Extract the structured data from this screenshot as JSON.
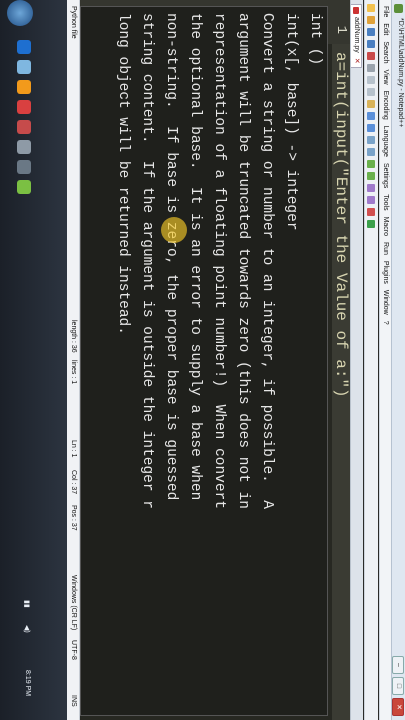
{
  "window": {
    "title": "*D:\\HTML\\addNum.py - Notepad++",
    "controls": [
      "–",
      "□",
      "✕"
    ]
  },
  "menu": [
    "File",
    "Edit",
    "Search",
    "View",
    "Encoding",
    "Language",
    "Settings",
    "Tools",
    "Macro",
    "Run",
    "Plugins",
    "Window",
    "?"
  ],
  "tab": {
    "label": "addNum.py"
  },
  "editor": {
    "line_number": "1",
    "code": "a=int(input(\"Enter the Value of a:\")"
  },
  "calltip": {
    "lines": [
      "int ()",
      "int(x[, base]) -> integer",
      "Convert a string or number to an integer, if possible.  A",
      "argument will be truncated towards zero (this does not in",
      "representation of a floating point number!)  When convert",
      "the optional base.  It is an error to supply a base when",
      "non-string.  If base is zero, the proper base is guessed",
      "string content.  If the argument is outside the integer r",
      "long object will be returned instead."
    ]
  },
  "status": {
    "file_type": "Python file",
    "length": "length : 36",
    "lines": "lines : 1",
    "ln": "Ln : 1",
    "col": "Col : 37",
    "pos": "Pos : 37",
    "eol": "Windows (CR LF)",
    "encoding": "UTF-8",
    "ins": "INS"
  },
  "taskbar": {
    "clock": "8:19 PM"
  },
  "colors": {
    "editor_bg": "#272822",
    "calltip_bg": "#1f201c",
    "tab_icon": "#cc3333",
    "cursor_highlight": "#f5c828"
  }
}
